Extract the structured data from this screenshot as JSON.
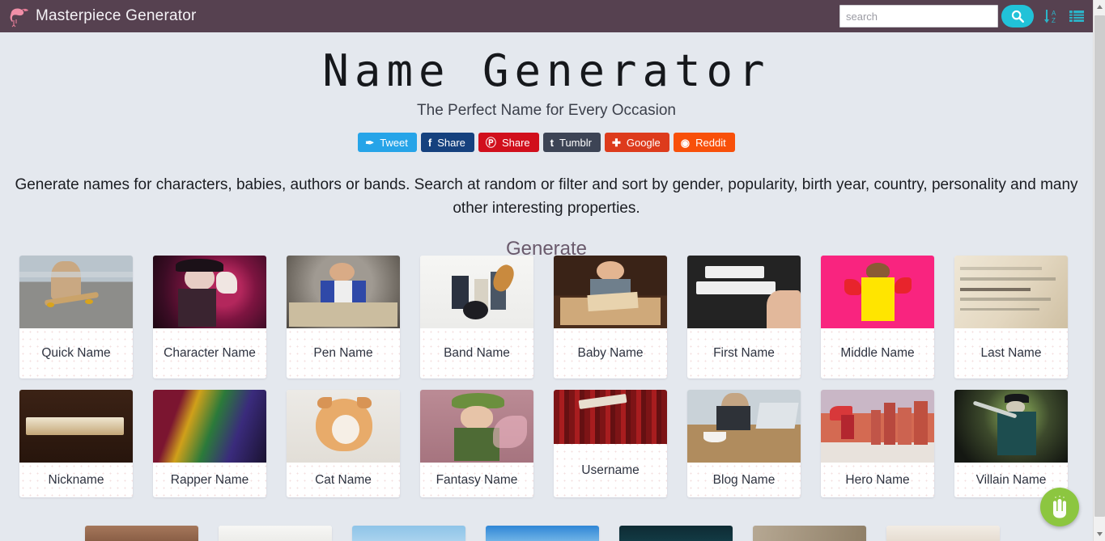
{
  "header": {
    "brand": "Masterpiece Generator",
    "logo_icon": "flamingo-icon",
    "search_placeholder": "search",
    "search_value": "",
    "search_icon": "search-icon",
    "sort_icon": "sort-alpha-down-icon",
    "list_icon": "list-menu-icon",
    "bg_color": "#564150",
    "accent_color": "#21c2d8"
  },
  "hero": {
    "title": "Name Generator",
    "subtitle": "The Perfect Name for Every Occasion",
    "description": "Generate names for characters, babies, authors or bands. Search at random or filter and sort by gender, popularity, birth year, country, personality and many other interesting properties."
  },
  "share_buttons": [
    {
      "label": "Tweet",
      "icon": "twitter-icon",
      "glyph": "✒",
      "color": "#26a4e8"
    },
    {
      "label": "Share",
      "icon": "facebook-icon",
      "glyph": "f",
      "color": "#15417e"
    },
    {
      "label": "Share",
      "icon": "pinterest-icon",
      "glyph": "Ⓟ",
      "color": "#d10f1c"
    },
    {
      "label": "Tumblr",
      "icon": "tumblr-icon",
      "glyph": "t",
      "color": "#3d4455"
    },
    {
      "label": "Google",
      "icon": "google-plus-icon",
      "glyph": "✚",
      "color": "#dd3b1c"
    },
    {
      "label": "Reddit",
      "icon": "reddit-icon",
      "glyph": "◉",
      "color": "#f8500a"
    }
  ],
  "section": {
    "generate_heading": "Generate"
  },
  "cards": {
    "row1": [
      {
        "label": "Quick Name",
        "image": "woman-on-skateboard-photo",
        "shape": "normal"
      },
      {
        "label": "Character Name",
        "image": "gothic-costume-woman-photo",
        "shape": "tall"
      },
      {
        "label": "Pen Name",
        "image": "woman-writing-with-books-photo",
        "shape": "normal"
      },
      {
        "label": "Band Name",
        "image": "rock-band-playing-photo",
        "shape": "normal"
      },
      {
        "label": "Baby Name",
        "image": "baby-reading-book-photo",
        "shape": "normal"
      },
      {
        "label": "First Name",
        "image": "hello-my-name-is-chalkboard-photo",
        "shape": "normal"
      },
      {
        "label": "Middle Name",
        "image": "woman-yellow-dress-pink-bg-photo",
        "shape": "normal"
      },
      {
        "label": "Last Name",
        "image": "dictionary-surname-page-photo",
        "shape": "normal"
      }
    ],
    "row2": [
      {
        "label": "Nickname",
        "image": "nickname-wood-text-photo",
        "shape": "normal"
      },
      {
        "label": "Rapper Name",
        "image": "rapper-with-microphone-photo",
        "shape": "normal"
      },
      {
        "label": "Cat Name",
        "image": "ginger-kitten-photo",
        "shape": "normal"
      },
      {
        "label": "Fantasy Name",
        "image": "fairy-with-flower-crown-photo",
        "shape": "normal"
      },
      {
        "label": "Username",
        "image": "username-sign-on-red-door-photo",
        "shape": "short"
      },
      {
        "label": "Blog Name",
        "image": "woman-blogging-at-cafe-photo",
        "shape": "normal"
      },
      {
        "label": "Hero Name",
        "image": "superhero-running-city-photo",
        "shape": "normal"
      },
      {
        "label": "Villain Name",
        "image": "pirate-villain-with-sword-photo",
        "shape": "normal"
      }
    ],
    "row3": [
      {
        "label": "",
        "image": "brown-leather-photo",
        "shape": "clipped"
      },
      {
        "label": "",
        "image": "food-plate-photo",
        "shape": "clipped"
      },
      {
        "label": "",
        "image": "blue-sky-tower-photo",
        "shape": "clipped"
      },
      {
        "label": "",
        "image": "clouds-blue-sky-photo",
        "shape": "clipped"
      },
      {
        "label": "",
        "image": "night-sailboat-photo",
        "shape": "clipped"
      },
      {
        "label": "",
        "image": "stone-arch-corridor-photo",
        "shape": "clipped"
      },
      {
        "label": "",
        "image": "blonde-portrait-photo",
        "shape": "clipped"
      }
    ]
  },
  "fab": {
    "icon": "touch-hand-icon",
    "color": "#8cc640"
  },
  "scrollbar": {
    "up_icon": "scroll-up-arrow-icon",
    "down_icon": "scroll-down-arrow-icon"
  }
}
